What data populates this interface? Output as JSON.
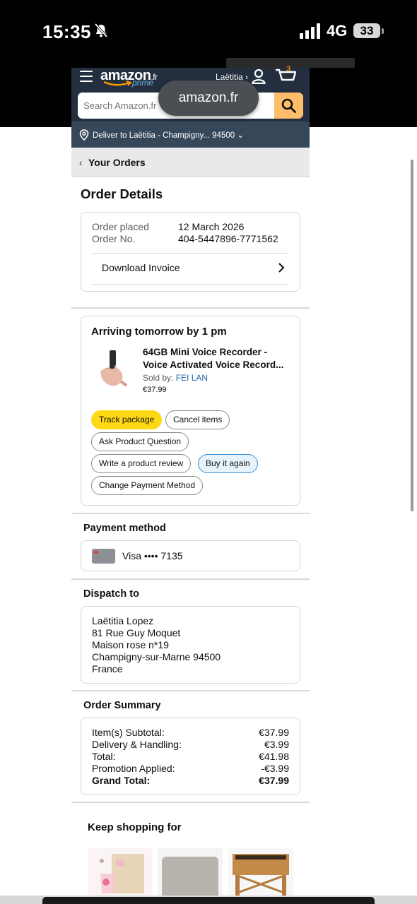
{
  "status_bar": {
    "time": "15:35",
    "network": "4G",
    "battery": "33"
  },
  "header": {
    "logo": "amazon",
    "logo_suffix": ".fr",
    "prime": "prime",
    "user": "Laëtitia ›",
    "cart_count": "3",
    "search_placeholder": "Search Amazon.fr",
    "url_pill": "amazon.fr",
    "deliver_to": "Deliver to Laëtitia - Champigny... 94500 ⌄"
  },
  "breadcrumb": {
    "back_label": "Your Orders"
  },
  "order_details": {
    "title": "Order Details",
    "placed_label": "Order placed",
    "placed_value": "12 March 2026",
    "number_label": "Order No.",
    "number_value": "404-5447896-7771562",
    "download_invoice": "Download Invoice"
  },
  "shipment": {
    "status": "Arriving tomorrow by 1 pm",
    "product_name": "64GB Mini Voice Recorder - Voice Activated Voice Record...",
    "sold_by_label": "Sold by:",
    "seller": "FEI LAN",
    "price": "€37.99",
    "actions": {
      "track": "Track package",
      "cancel": "Cancel items",
      "ask": "Ask Product Question",
      "review": "Write a product review",
      "buy_again": "Buy it again",
      "change_payment": "Change Payment Method"
    }
  },
  "payment": {
    "title": "Payment method",
    "card": "Visa •••• 7135"
  },
  "dispatch": {
    "title": "Dispatch to",
    "lines": [
      "Laëtitia Lopez",
      "81 Rue Guy Moquet",
      "Maison rose n*19",
      "Champigny-sur-Marne 94500",
      "France"
    ]
  },
  "summary": {
    "title": "Order Summary",
    "rows": [
      {
        "label": "Item(s) Subtotal:",
        "value": "€37.99"
      },
      {
        "label": "Delivery & Handling:",
        "value": "€3.99"
      },
      {
        "label": "Total:",
        "value": "€41.98"
      },
      {
        "label": "Promotion Applied:",
        "value": "-€3.99"
      },
      {
        "label": "Grand Total:",
        "value": "€37.99"
      }
    ]
  },
  "keep_shopping": {
    "title": "Keep shopping for"
  },
  "colors": {
    "header_bg": "#232f3e",
    "deliver_bg": "#37475a",
    "search_btn": "#febd69",
    "track_btn": "#ffd814",
    "link": "#2162a1"
  }
}
